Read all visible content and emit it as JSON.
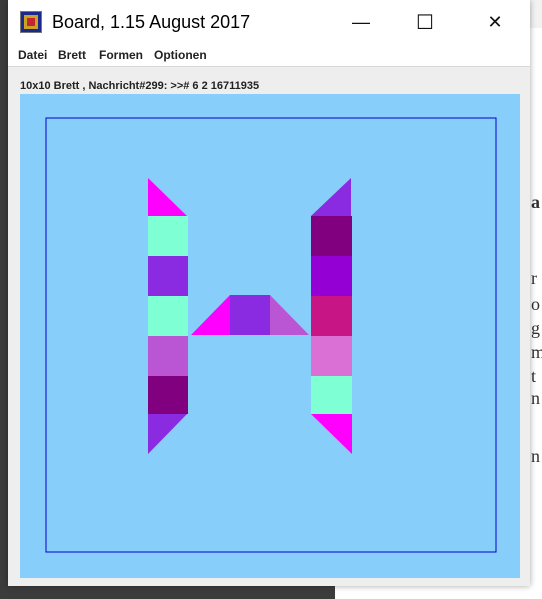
{
  "window": {
    "title": "Board, 1.15 August 2017",
    "icon": "board-app-icon",
    "controls": {
      "minimize_glyph": "—",
      "maximize_glyph": "☐",
      "close_glyph": "✕"
    }
  },
  "menu": {
    "items": [
      "Datei",
      "Brett",
      "Formen",
      "Optionen"
    ]
  },
  "status": {
    "text": "10x10 Brett , Nachricht#299: >># 6 2 16711935"
  },
  "board": {
    "background": "#87cefa",
    "border_color": "#0000cd",
    "colors": {
      "magenta": "#ff00ff",
      "aquamarine": "#7fffd4",
      "blueviolet": "#8a2be2",
      "mediumorchid": "#ba55d3",
      "purple": "#800080",
      "darkviolet": "#9400d3",
      "mediumvioletred": "#c71585",
      "orchid": "#da70d6"
    }
  },
  "background_app": {
    "glyphs": [
      "a",
      "r",
      "o",
      "g",
      "m",
      "t",
      "n",
      "n"
    ]
  }
}
